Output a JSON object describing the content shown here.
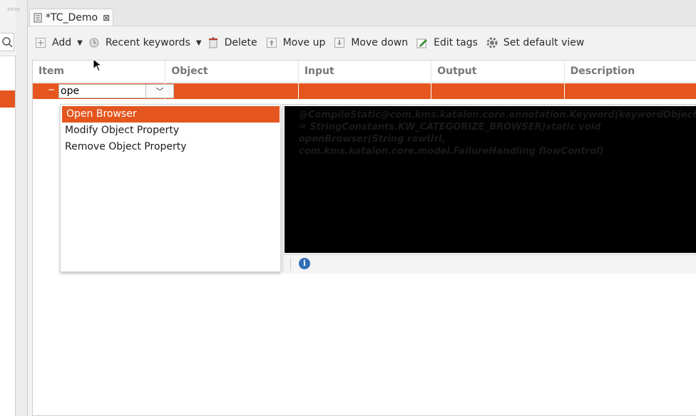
{
  "tab": {
    "title": "*TC_Demo",
    "close_glyph": "⊠"
  },
  "toolbar": {
    "add": "Add",
    "recent_keywords": "Recent keywords",
    "delete": "Delete",
    "move_up": "Move up",
    "move_down": "Move down",
    "edit_tags": "Edit tags",
    "set_default_view": "Set default view"
  },
  "grid": {
    "columns": [
      "Item",
      "Object",
      "Input",
      "Output",
      "Description"
    ],
    "editing_value": "ope"
  },
  "suggestions": [
    "Open Browser",
    "Modify Object Property",
    "Remove Object Property"
  ],
  "doc": {
    "text": "@CompileStatic@com.kms.katalon.core.annotation.Keyword(keywordObject = StringConstants.KW_CATEGORIZE_BROWSER)static void openBrowser(String rawUrl, com.kms.katalon.core.model.FailureHandling flowControl)"
  },
  "colors": {
    "accent": "#e4561e",
    "info": "#2f6db5"
  }
}
